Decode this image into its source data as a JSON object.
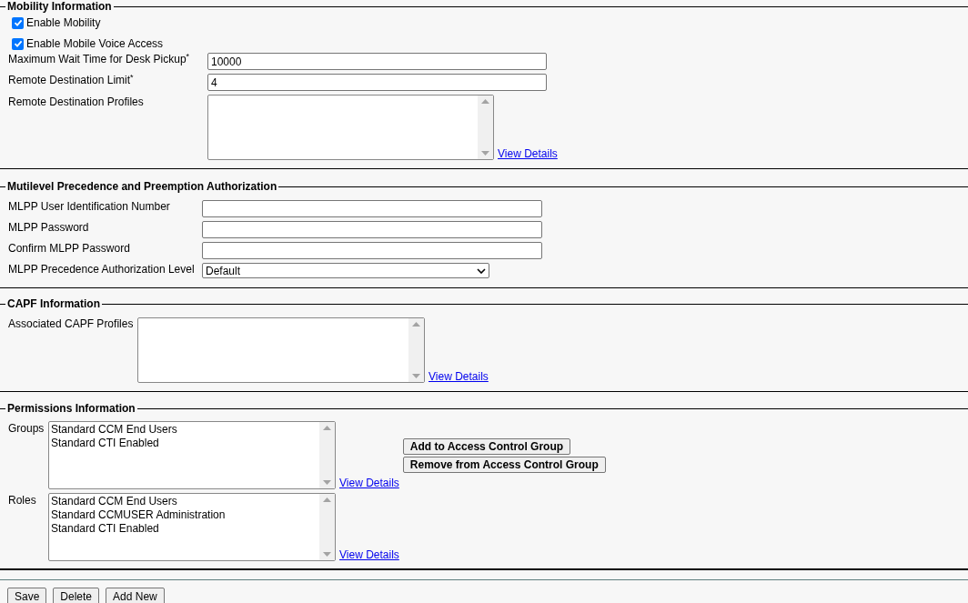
{
  "mobility": {
    "title": "Mobility Information",
    "checkboxes": [
      {
        "label": "Enable Mobility",
        "checked": true
      },
      {
        "label": "Enable Mobile Voice Access",
        "checked": true
      }
    ],
    "fields": [
      {
        "label": "Maximum Wait Time for Desk Pickup$^{*}$",
        "value": "10000"
      },
      {
        "label": "Remote Destination Limit$^{*}$",
        "value": "4"
      }
    ],
    "profiles": {
      "label": "Remote Destination Profiles",
      "link": "View Details"
    }
  },
  "mlpp": {
    "title": "Mutilevel Precedence and Preemption Authorization",
    "fields": [
      {
        "label": "MLPP User Identification Number"
      },
      {
        "label": "MLPP Password"
      },
      {
        "label": "Confirm MLPP Password"
      }
    ],
    "select": {
      "label": "MLPP Precedence Authorization Level",
      "value": "Default"
    }
  },
  "capf": {
    "title": "CAPF Information",
    "profiles": {
      "label": "Associated CAPF Profiles",
      "link": "View Details"
    }
  },
  "permissions": {
    "title": "Permissions Information",
    "groups": {
      "label": "Groups",
      "items": [
        "Standard CCM End Users",
        "Standard CTI Enabled"
      ],
      "link": "View Details"
    },
    "roles": {
      "label": "Roles",
      "items": [
        "Standard CCM End Users",
        "Standard CCMUSER Administration",
        "Standard CTI Enabled"
      ],
      "link": "View Details"
    },
    "buttons": [
      "Add to Access Control Group",
      "Remove from Access Control Group"
    ]
  },
  "footer_buttons": [
    "Save",
    "Delete",
    "Add New"
  ]
}
